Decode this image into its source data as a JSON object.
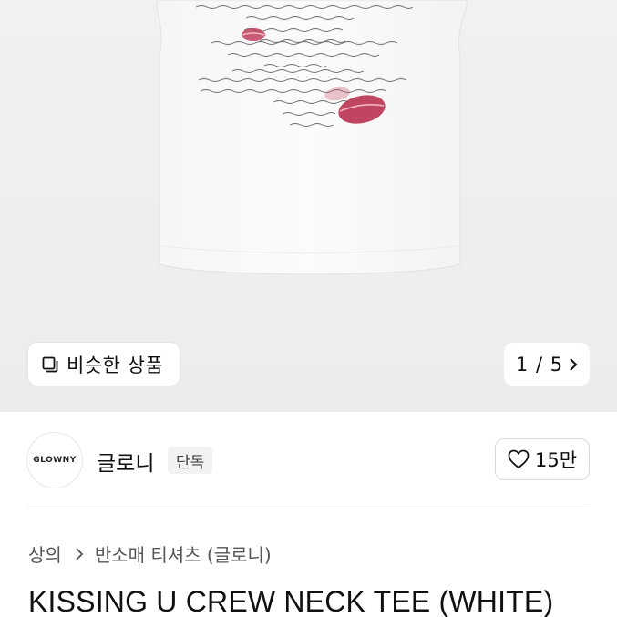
{
  "hero": {
    "similar_button_label": "비슷한 상품",
    "pager_text": "1 / 5",
    "icons": [
      "similar-items-icon",
      "chevron-right-icon"
    ]
  },
  "brand": {
    "logo_text": "GLOWNY",
    "name": "글로니",
    "badge": "단독",
    "like_count": "15만"
  },
  "breadcrumb": {
    "category": "상의",
    "subcategory": "반소매 티셔츠 (글로니)"
  },
  "product": {
    "title": "KISSING U CREW NECK TEE (WHITE)"
  }
}
